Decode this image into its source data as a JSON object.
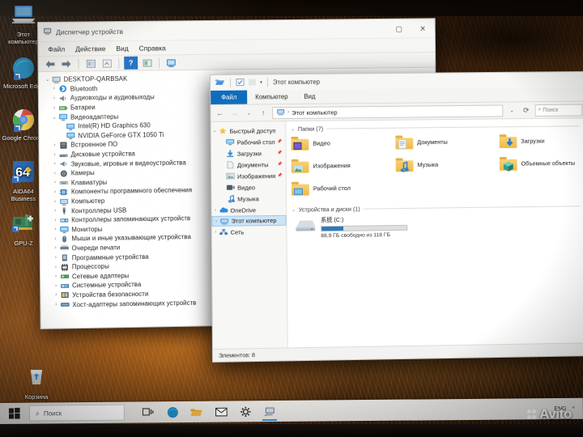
{
  "desktop": {
    "icons": [
      {
        "name": "this-pc",
        "label": "Этот\nкомпьютер",
        "glyph": "this-pc-icon"
      },
      {
        "name": "microsoft-edge",
        "label": "Microsoft\nEdge",
        "glyph": "edge-icon"
      },
      {
        "name": "google-chrome",
        "label": "Google\nChrome",
        "glyph": "chrome-icon"
      },
      {
        "name": "aida64",
        "label": "AIDA64\nBusiness",
        "glyph": "aida64-icon"
      },
      {
        "name": "gpu-z",
        "label": "GPU-Z",
        "glyph": "gpuz-icon"
      },
      {
        "name": "recycle-bin",
        "label": "Корзина",
        "glyph": "recycle-bin-icon"
      }
    ]
  },
  "device_manager": {
    "title": "Диспетчер устройств",
    "menu": [
      "Файл",
      "Действие",
      "Вид",
      "Справка"
    ],
    "window_buttons": {
      "maximize": "▢",
      "close": "✕"
    },
    "root": "DESKTOP-QARBSAK",
    "tree": [
      {
        "label": "Bluetooth",
        "level": 1,
        "expanded": false,
        "icon": "bluetooth-icon"
      },
      {
        "label": "Аудиовходы и аудиовыходы",
        "level": 1,
        "expanded": false,
        "icon": "audio-icon"
      },
      {
        "label": "Батареи",
        "level": 1,
        "expanded": false,
        "icon": "battery-icon"
      },
      {
        "label": "Видеоадаптеры",
        "level": 1,
        "expanded": true,
        "icon": "display-adapter-icon"
      },
      {
        "label": "Intel(R) HD Graphics 630",
        "level": 2,
        "expanded": null,
        "icon": "display-adapter-icon"
      },
      {
        "label": "NVIDIA GeForce GTX 1050 Ti",
        "level": 2,
        "expanded": null,
        "icon": "display-adapter-icon"
      },
      {
        "label": "Встроенное ПО",
        "level": 1,
        "expanded": false,
        "icon": "firmware-icon"
      },
      {
        "label": "Дисковые устройства",
        "level": 1,
        "expanded": false,
        "icon": "disk-icon"
      },
      {
        "label": "Звуковые, игровые и видеоустройства",
        "level": 1,
        "expanded": false,
        "icon": "audio-icon"
      },
      {
        "label": "Камеры",
        "level": 1,
        "expanded": false,
        "icon": "camera-icon"
      },
      {
        "label": "Клавиатуры",
        "level": 1,
        "expanded": false,
        "icon": "keyboard-icon"
      },
      {
        "label": "Компоненты программного обеспечения",
        "level": 1,
        "expanded": false,
        "icon": "software-component-icon"
      },
      {
        "label": "Компьютер",
        "level": 1,
        "expanded": false,
        "icon": "computer-icon"
      },
      {
        "label": "Контроллеры USB",
        "level": 1,
        "expanded": false,
        "icon": "usb-icon"
      },
      {
        "label": "Контроллеры запоминающих устройств",
        "level": 1,
        "expanded": false,
        "icon": "storage-controller-icon"
      },
      {
        "label": "Мониторы",
        "level": 1,
        "expanded": false,
        "icon": "monitor-icon"
      },
      {
        "label": "Мыши и иные указывающие устройства",
        "level": 1,
        "expanded": false,
        "icon": "mouse-icon"
      },
      {
        "label": "Очереди печати",
        "level": 1,
        "expanded": false,
        "icon": "printer-icon"
      },
      {
        "label": "Программные устройства",
        "level": 1,
        "expanded": false,
        "icon": "software-device-icon"
      },
      {
        "label": "Процессоры",
        "level": 1,
        "expanded": false,
        "icon": "processor-icon"
      },
      {
        "label": "Сетевые адаптеры",
        "level": 1,
        "expanded": false,
        "icon": "network-adapter-icon"
      },
      {
        "label": "Системные устройства",
        "level": 1,
        "expanded": false,
        "icon": "system-device-icon"
      },
      {
        "label": "Устройства безопасности",
        "level": 1,
        "expanded": false,
        "icon": "security-device-icon"
      },
      {
        "label": "Хост-адаптеры запоминающих устройств",
        "level": 1,
        "expanded": false,
        "icon": "host-adapter-icon"
      }
    ]
  },
  "explorer": {
    "title": "Этот компьютер",
    "ribbon_tabs": [
      "Файл",
      "Компьютер",
      "Вид"
    ],
    "address": "Этот компьютер",
    "search_placeholder": "Поиск",
    "nav": [
      {
        "label": "Быстрый доступ",
        "level": 0,
        "expanded": true,
        "pinned": false,
        "icon": "star-icon"
      },
      {
        "label": "Рабочий стол",
        "level": 1,
        "expanded": null,
        "pinned": true,
        "icon": "desktop-icon"
      },
      {
        "label": "Загрузки",
        "level": 1,
        "expanded": null,
        "pinned": true,
        "icon": "downloads-icon"
      },
      {
        "label": "Документы",
        "level": 1,
        "expanded": null,
        "pinned": true,
        "icon": "documents-icon"
      },
      {
        "label": "Изображения",
        "level": 1,
        "expanded": null,
        "pinned": true,
        "icon": "pictures-icon"
      },
      {
        "label": "Видео",
        "level": 1,
        "expanded": null,
        "pinned": false,
        "icon": "videos-icon"
      },
      {
        "label": "Музыка",
        "level": 1,
        "expanded": null,
        "pinned": false,
        "icon": "music-icon"
      },
      {
        "label": "OneDrive",
        "level": 0,
        "expanded": false,
        "pinned": false,
        "icon": "onedrive-icon"
      },
      {
        "label": "Этот компьютер",
        "level": 0,
        "expanded": false,
        "pinned": false,
        "icon": "this-pc-icon",
        "selected": true
      },
      {
        "label": "Сеть",
        "level": 0,
        "expanded": false,
        "pinned": false,
        "icon": "network-icon"
      }
    ],
    "folders_group": "Папки (7)",
    "folders": [
      {
        "label": "Видео",
        "icon": "videos-folder-icon"
      },
      {
        "label": "Документы",
        "icon": "documents-folder-icon"
      },
      {
        "label": "Загрузки",
        "icon": "downloads-folder-icon"
      },
      {
        "label": "Изображения",
        "icon": "pictures-folder-icon"
      },
      {
        "label": "Музыка",
        "icon": "music-folder-icon"
      },
      {
        "label": "Объемные объекты",
        "icon": "3d-objects-folder-icon"
      },
      {
        "label": "Рабочий стол",
        "icon": "desktop-folder-icon"
      }
    ],
    "drives_group": "Устройства и диски (1)",
    "drive": {
      "label": "系统 (C:)",
      "free_text": "88,9 ГБ свободно из 118 ГБ",
      "used_percent": 25
    },
    "status": "Элементов: 8"
  },
  "taskbar": {
    "search_placeholder": "Поиск",
    "items": [
      {
        "name": "task-view",
        "glyph": "⊞"
      },
      {
        "name": "microsoft-edge",
        "glyph": "edge"
      },
      {
        "name": "file-explorer",
        "glyph": "folder"
      },
      {
        "name": "mail",
        "glyph": "✉"
      },
      {
        "name": "settings",
        "glyph": "⚙"
      },
      {
        "name": "device-manager",
        "glyph": "devmgr",
        "active": true
      }
    ],
    "tray": [
      "ENG",
      "^"
    ]
  },
  "watermark": {
    "text": "Avito"
  },
  "colors": {
    "accent": "#0f6cbd",
    "selection": "#cde4f7",
    "drive_bar": "#2779c4",
    "folder": "#eeb947"
  }
}
